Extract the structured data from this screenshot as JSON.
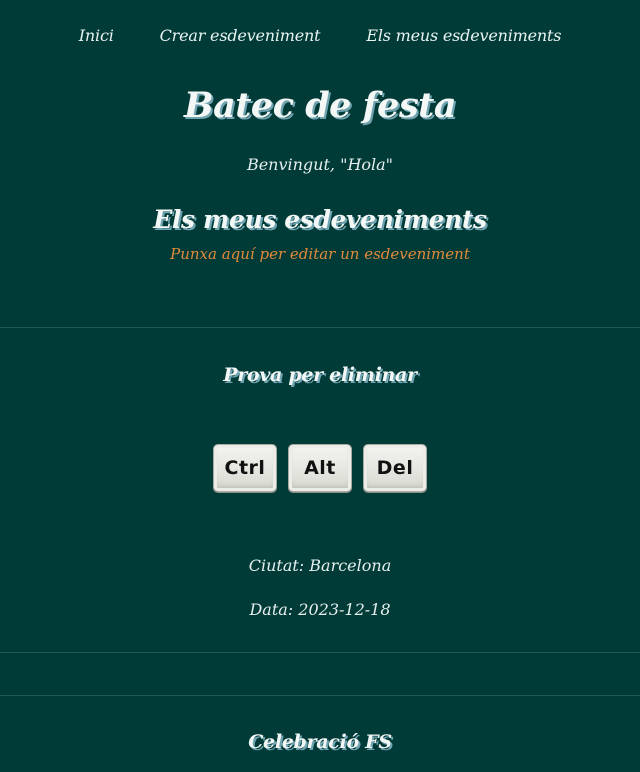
{
  "nav": {
    "items": [
      "Inici",
      "Crear esdeveniment",
      "Els meus esdeveniments"
    ]
  },
  "header": {
    "site_title": "Batec de festa",
    "welcome": "Benvingut, \"Hola\""
  },
  "main": {
    "section_title": "Els meus esdeveniments",
    "edit_hint": "Punxa aquí per editar un esdeveniment",
    "events": [
      {
        "title": "Prova per eliminar",
        "image_keys": [
          "Ctrl",
          "Alt",
          "Del"
        ],
        "city_label": "Ciutat: Barcelona",
        "date_label": "Data: 2023-12-18"
      },
      {
        "title": "Celebració FS"
      }
    ]
  },
  "colors": {
    "background": "#003b37",
    "text": "#e6efee",
    "accent_link": "#e08a3a",
    "title_shadow": "#6fa3b0",
    "divider": "#1e5a54"
  }
}
